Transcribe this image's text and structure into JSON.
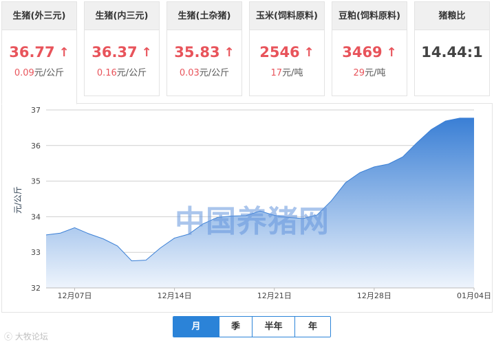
{
  "cards": [
    {
      "title": "生猪(外三元)",
      "price": "36.77",
      "delta_value": "0.09",
      "delta_unit": "元/公斤",
      "trend": "up"
    },
    {
      "title": "生猪(内三元)",
      "price": "36.37",
      "delta_value": "0.16",
      "delta_unit": "元/公斤",
      "trend": "up"
    },
    {
      "title": "生猪(土杂猪)",
      "price": "35.83",
      "delta_value": "0.03",
      "delta_unit": "元/公斤",
      "trend": "up"
    },
    {
      "title": "玉米(饲料原料)",
      "price": "2546",
      "delta_value": "17",
      "delta_unit": "元/吨",
      "trend": "up"
    },
    {
      "title": "豆粕(饲料原料)",
      "price": "3469",
      "delta_value": "29",
      "delta_unit": "元/吨",
      "trend": "up"
    },
    {
      "title": "猪粮比",
      "price": "14.44:1"
    }
  ],
  "arrow_glyph": "🡅",
  "watermark": "中国养猪网",
  "tabs": [
    {
      "label": "月",
      "active": true
    },
    {
      "label": "季",
      "active": false
    },
    {
      "label": "半年",
      "active": false
    },
    {
      "label": "年",
      "active": false
    }
  ],
  "brand_mark": "大牧论坛",
  "colors": {
    "accent": "#2b83d8",
    "up": "#e8545b",
    "area_top": "#3a7fd5",
    "area_bottom": "#eef4fc"
  },
  "chart_data": {
    "type": "area",
    "ylabel": "元/公斤",
    "ylim": [
      32,
      37
    ],
    "yticks": [
      32,
      33,
      34,
      35,
      36,
      37
    ],
    "xtick_labels": [
      "12月07日",
      "12月14日",
      "12月21日",
      "12月28日",
      "01月04日"
    ],
    "x": [
      "12-05",
      "12-06",
      "12-07",
      "12-08",
      "12-09",
      "12-10",
      "12-11",
      "12-12",
      "12-13",
      "12-14",
      "12-15",
      "12-16",
      "12-17",
      "12-18",
      "12-19",
      "12-20",
      "12-21",
      "12-22",
      "12-23",
      "12-24",
      "12-25",
      "12-26",
      "12-27",
      "12-28",
      "12-29",
      "12-30",
      "12-31",
      "01-01",
      "01-02",
      "01-03",
      "01-04"
    ],
    "values": [
      33.49,
      33.54,
      33.69,
      33.52,
      33.38,
      33.18,
      32.76,
      32.78,
      33.12,
      33.4,
      33.51,
      33.8,
      33.98,
      34.02,
      34.03,
      34.16,
      34.04,
      33.98,
      33.95,
      34.05,
      34.45,
      34.96,
      35.24,
      35.4,
      35.48,
      35.68,
      36.08,
      36.45,
      36.69,
      36.77,
      36.77
    ],
    "grid": true
  }
}
